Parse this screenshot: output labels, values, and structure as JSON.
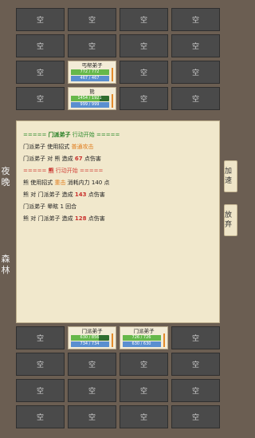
{
  "empty_label": "空",
  "top_grid": [
    [
      "空",
      "空",
      "空",
      "空"
    ],
    [
      "空",
      "空",
      "空",
      "空"
    ],
    [
      "空",
      {
        "name": "丐帮弟子",
        "hp": "772 / 772",
        "mp": "467 / 467",
        "hp_pct": 1.0,
        "mp_pct": 1.0
      },
      "空",
      "空"
    ],
    [
      "空",
      {
        "name": "熊",
        "hp": "1454 / 1921",
        "mp": "999 / 999",
        "hp_pct": 0.76,
        "mp_pct": 1.0
      },
      "空",
      "空"
    ]
  ],
  "bottom_grid": [
    [
      "空",
      {
        "name": "门派弟子",
        "hp": "630 / 856",
        "mp": "734 / 734",
        "hp_pct": 0.74,
        "mp_pct": 1.0
      },
      {
        "name": "门派弟子",
        "hp": "726 / 726",
        "mp": "630 / 630",
        "hp_pct": 1.0,
        "mp_pct": 1.0
      },
      "空"
    ],
    [
      "空",
      "空",
      "空",
      "空"
    ],
    [
      "空",
      "空",
      "空",
      "空"
    ],
    [
      "空",
      "空",
      "空",
      "空"
    ]
  ],
  "log": [
    [
      {
        "t": "===== ",
        "c": "green"
      },
      {
        "t": "门派弟子",
        "c": "greenb"
      },
      {
        "t": " 行动开始 =====",
        "c": "green"
      }
    ],
    [
      {
        "t": "门派弟子 使用招式 "
      },
      {
        "t": "普通攻击",
        "c": "orange"
      }
    ],
    [
      {
        "t": "门派弟子 对 熊 造成 "
      },
      {
        "t": "67",
        "c": "redb"
      },
      {
        "t": " 点伤害"
      }
    ],
    [
      {
        "t": "===== ",
        "c": "red"
      },
      {
        "t": "熊",
        "c": "redb"
      },
      {
        "t": " 行动开始 =====",
        "c": "red"
      }
    ],
    [
      {
        "t": "熊 使用招式 "
      },
      {
        "t": "重击",
        "c": "orange"
      },
      {
        "t": " 消耗内力 140 点"
      }
    ],
    [
      {
        "t": "熊 对 门派弟子 造成 "
      },
      {
        "t": "143",
        "c": "redb"
      },
      {
        "t": " 点伤害"
      }
    ],
    [
      {
        "t": "门派弟子 晕眩 1 回合"
      }
    ],
    [
      {
        "t": "熊 对 门派弟子 造成 "
      },
      {
        "t": "128",
        "c": "redb"
      },
      {
        "t": " 点伤害"
      }
    ]
  ],
  "left_labels": {
    "time": "夜晚",
    "location": "森林"
  },
  "buttons": {
    "speed": "加速",
    "give_up": "放弃"
  }
}
